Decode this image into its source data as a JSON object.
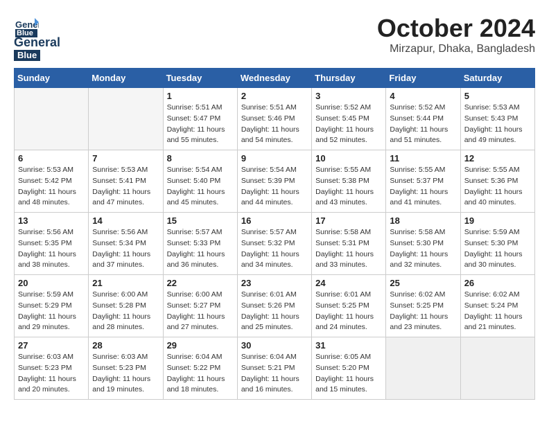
{
  "logo": {
    "general": "General",
    "blue": "Blue"
  },
  "title": "October 2024",
  "location": "Mirzapur, Dhaka, Bangladesh",
  "headers": [
    "Sunday",
    "Monday",
    "Tuesday",
    "Wednesday",
    "Thursday",
    "Friday",
    "Saturday"
  ],
  "weeks": [
    [
      {
        "day": "",
        "info": ""
      },
      {
        "day": "",
        "info": ""
      },
      {
        "day": "1",
        "info": "Sunrise: 5:51 AM\nSunset: 5:47 PM\nDaylight: 11 hours\nand 55 minutes."
      },
      {
        "day": "2",
        "info": "Sunrise: 5:51 AM\nSunset: 5:46 PM\nDaylight: 11 hours\nand 54 minutes."
      },
      {
        "day": "3",
        "info": "Sunrise: 5:52 AM\nSunset: 5:45 PM\nDaylight: 11 hours\nand 52 minutes."
      },
      {
        "day": "4",
        "info": "Sunrise: 5:52 AM\nSunset: 5:44 PM\nDaylight: 11 hours\nand 51 minutes."
      },
      {
        "day": "5",
        "info": "Sunrise: 5:53 AM\nSunset: 5:43 PM\nDaylight: 11 hours\nand 49 minutes."
      }
    ],
    [
      {
        "day": "6",
        "info": "Sunrise: 5:53 AM\nSunset: 5:42 PM\nDaylight: 11 hours\nand 48 minutes."
      },
      {
        "day": "7",
        "info": "Sunrise: 5:53 AM\nSunset: 5:41 PM\nDaylight: 11 hours\nand 47 minutes."
      },
      {
        "day": "8",
        "info": "Sunrise: 5:54 AM\nSunset: 5:40 PM\nDaylight: 11 hours\nand 45 minutes."
      },
      {
        "day": "9",
        "info": "Sunrise: 5:54 AM\nSunset: 5:39 PM\nDaylight: 11 hours\nand 44 minutes."
      },
      {
        "day": "10",
        "info": "Sunrise: 5:55 AM\nSunset: 5:38 PM\nDaylight: 11 hours\nand 43 minutes."
      },
      {
        "day": "11",
        "info": "Sunrise: 5:55 AM\nSunset: 5:37 PM\nDaylight: 11 hours\nand 41 minutes."
      },
      {
        "day": "12",
        "info": "Sunrise: 5:55 AM\nSunset: 5:36 PM\nDaylight: 11 hours\nand 40 minutes."
      }
    ],
    [
      {
        "day": "13",
        "info": "Sunrise: 5:56 AM\nSunset: 5:35 PM\nDaylight: 11 hours\nand 38 minutes."
      },
      {
        "day": "14",
        "info": "Sunrise: 5:56 AM\nSunset: 5:34 PM\nDaylight: 11 hours\nand 37 minutes."
      },
      {
        "day": "15",
        "info": "Sunrise: 5:57 AM\nSunset: 5:33 PM\nDaylight: 11 hours\nand 36 minutes."
      },
      {
        "day": "16",
        "info": "Sunrise: 5:57 AM\nSunset: 5:32 PM\nDaylight: 11 hours\nand 34 minutes."
      },
      {
        "day": "17",
        "info": "Sunrise: 5:58 AM\nSunset: 5:31 PM\nDaylight: 11 hours\nand 33 minutes."
      },
      {
        "day": "18",
        "info": "Sunrise: 5:58 AM\nSunset: 5:30 PM\nDaylight: 11 hours\nand 32 minutes."
      },
      {
        "day": "19",
        "info": "Sunrise: 5:59 AM\nSunset: 5:30 PM\nDaylight: 11 hours\nand 30 minutes."
      }
    ],
    [
      {
        "day": "20",
        "info": "Sunrise: 5:59 AM\nSunset: 5:29 PM\nDaylight: 11 hours\nand 29 minutes."
      },
      {
        "day": "21",
        "info": "Sunrise: 6:00 AM\nSunset: 5:28 PM\nDaylight: 11 hours\nand 28 minutes."
      },
      {
        "day": "22",
        "info": "Sunrise: 6:00 AM\nSunset: 5:27 PM\nDaylight: 11 hours\nand 27 minutes."
      },
      {
        "day": "23",
        "info": "Sunrise: 6:01 AM\nSunset: 5:26 PM\nDaylight: 11 hours\nand 25 minutes."
      },
      {
        "day": "24",
        "info": "Sunrise: 6:01 AM\nSunset: 5:25 PM\nDaylight: 11 hours\nand 24 minutes."
      },
      {
        "day": "25",
        "info": "Sunrise: 6:02 AM\nSunset: 5:25 PM\nDaylight: 11 hours\nand 23 minutes."
      },
      {
        "day": "26",
        "info": "Sunrise: 6:02 AM\nSunset: 5:24 PM\nDaylight: 11 hours\nand 21 minutes."
      }
    ],
    [
      {
        "day": "27",
        "info": "Sunrise: 6:03 AM\nSunset: 5:23 PM\nDaylight: 11 hours\nand 20 minutes."
      },
      {
        "day": "28",
        "info": "Sunrise: 6:03 AM\nSunset: 5:23 PM\nDaylight: 11 hours\nand 19 minutes."
      },
      {
        "day": "29",
        "info": "Sunrise: 6:04 AM\nSunset: 5:22 PM\nDaylight: 11 hours\nand 18 minutes."
      },
      {
        "day": "30",
        "info": "Sunrise: 6:04 AM\nSunset: 5:21 PM\nDaylight: 11 hours\nand 16 minutes."
      },
      {
        "day": "31",
        "info": "Sunrise: 6:05 AM\nSunset: 5:20 PM\nDaylight: 11 hours\nand 15 minutes."
      },
      {
        "day": "",
        "info": ""
      },
      {
        "day": "",
        "info": ""
      }
    ]
  ]
}
